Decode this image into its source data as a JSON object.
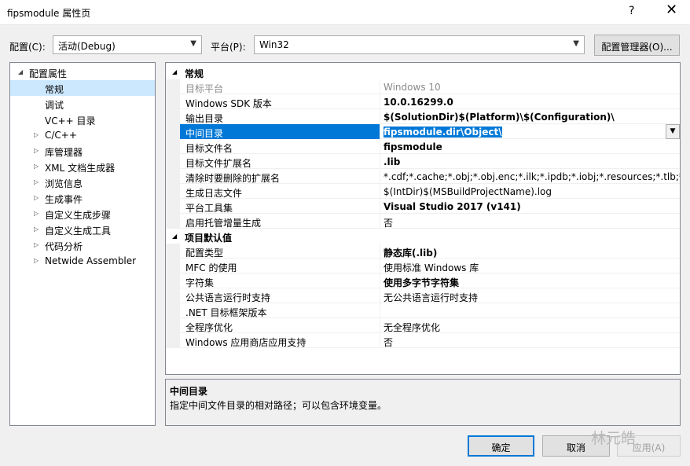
{
  "window": {
    "title": "fipsmodule 属性页",
    "help": "?",
    "close": "✕"
  },
  "config": {
    "config_label": "配置(C):",
    "config_value": "活动(Debug)",
    "platform_label": "平台(P):",
    "platform_value": "Win32",
    "manager_button": "配置管理器(O)..."
  },
  "tree": {
    "items": [
      {
        "label": "配置属性",
        "expanded": true
      },
      {
        "label": "常规"
      },
      {
        "label": "调试"
      },
      {
        "label": "VC++ 目录"
      },
      {
        "label": "C/C++"
      },
      {
        "label": "库管理器"
      },
      {
        "label": "XML 文档生成器"
      },
      {
        "label": "浏览信息"
      },
      {
        "label": "生成事件"
      },
      {
        "label": "自定义生成步骤"
      },
      {
        "label": "自定义生成工具"
      },
      {
        "label": "代码分析"
      },
      {
        "label": "Netwide Assembler"
      }
    ]
  },
  "grid": {
    "section1": "常规",
    "section2": "项目默认值",
    "rows1": [
      {
        "name": "目标平台",
        "value": "Windows 10"
      },
      {
        "name": "Windows SDK 版本",
        "value": "10.0.16299.0"
      },
      {
        "name": "输出目录",
        "value": "$(SolutionDir)$(Platform)\\$(Configuration)\\"
      },
      {
        "name": "中间目录",
        "value": "fipsmodule.dir\\Object\\"
      },
      {
        "name": "目标文件名",
        "value": "fipsmodule"
      },
      {
        "name": "目标文件扩展名",
        "value": ".lib"
      },
      {
        "name": "清除时要删除的扩展名",
        "value": "*.cdf;*.cache;*.obj;*.obj.enc;*.ilk;*.ipdb;*.iobj;*.resources;*.tlb;*.tli;*.t"
      },
      {
        "name": "生成日志文件",
        "value": "$(IntDir)$(MSBuildProjectName).log"
      },
      {
        "name": "平台工具集",
        "value": "Visual Studio 2017 (v141)"
      },
      {
        "name": "启用托管增量生成",
        "value": "否"
      }
    ],
    "rows2": [
      {
        "name": "配置类型",
        "value": "静态库(.lib)"
      },
      {
        "name": "MFC 的使用",
        "value": "使用标准 Windows 库"
      },
      {
        "name": "字符集",
        "value": "使用多字节字符集"
      },
      {
        "name": "公共语言运行时支持",
        "value": "无公共语言运行时支持"
      },
      {
        "name": ".NET 目标框架版本",
        "value": ""
      },
      {
        "name": "全程序优化",
        "value": "无全程序优化"
      },
      {
        "name": "Windows 应用商店应用支持",
        "value": "否"
      }
    ]
  },
  "description": {
    "title": "中间目录",
    "text": "指定中间文件目录的相对路径；可以包含环境变量。"
  },
  "buttons": {
    "ok": "确定",
    "cancel": "取消",
    "apply": "应用(A)"
  },
  "watermark": "林元皓"
}
